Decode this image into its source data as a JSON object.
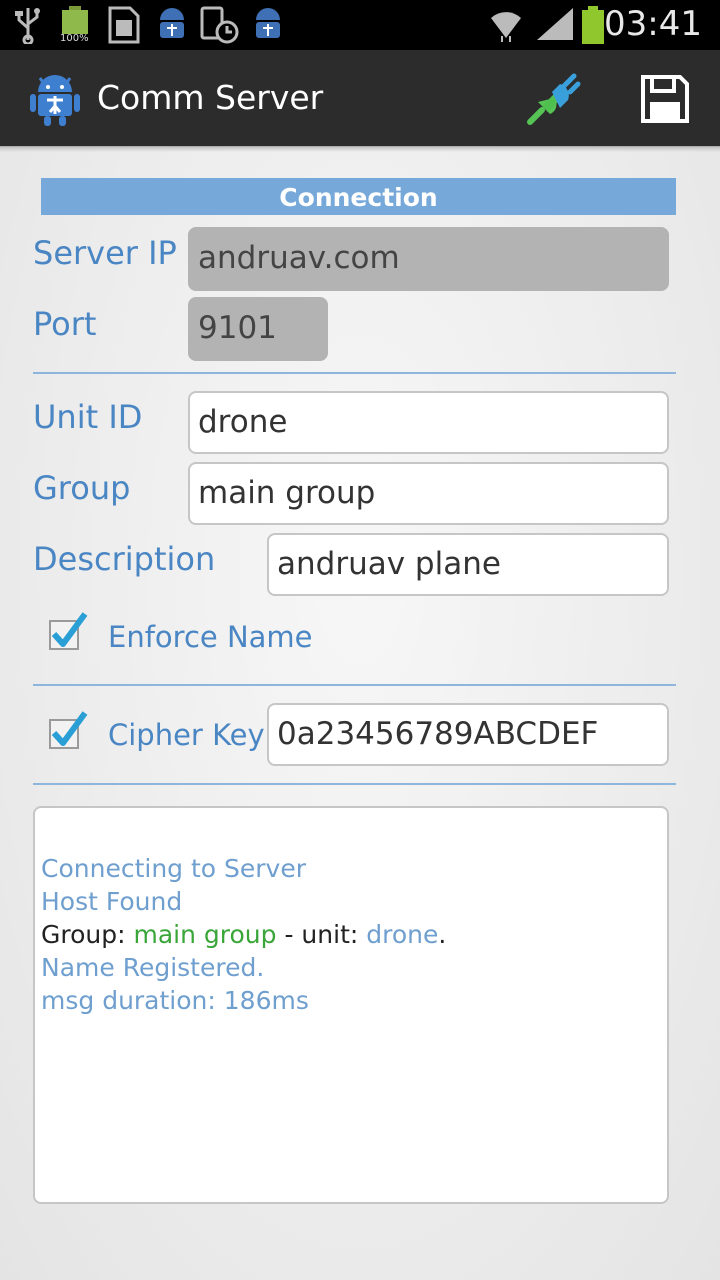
{
  "status_bar": {
    "time": "03:41",
    "battery_small_label": "100%",
    "icons": [
      "usb-icon",
      "battery-full-icon",
      "sd-card-icon",
      "android-app-icon",
      "screenshot-icon",
      "android-app-icon",
      "wifi-icon",
      "signal-icon",
      "battery-icon"
    ]
  },
  "action_bar": {
    "title": "Comm Server",
    "actions": [
      "connect-plug-icon",
      "save-floppy-icon"
    ]
  },
  "connection": {
    "header": "Connection",
    "server_ip_label": "Server IP",
    "server_ip_value": "andruav.com",
    "port_label": "Port",
    "port_value": "9101"
  },
  "identity": {
    "unit_id_label": "Unit ID",
    "unit_id_value": "drone",
    "group_label": "Group",
    "group_value": "main group",
    "description_label": "Description",
    "description_value": "andruav plane",
    "enforce_name_label": "Enforce Name",
    "enforce_name_checked": true
  },
  "cipher": {
    "label": "Cipher Key",
    "checked": true,
    "value": "0a23456789ABCDEF"
  },
  "log": {
    "line1": "Connecting to Server",
    "line2": "Host Found",
    "line3_prefix": "Group: ",
    "line3_group": "main group",
    "line3_mid": " - unit: ",
    "line3_unit": "drone",
    "line3_end": ".",
    "line4": "Name Registered.",
    "line5": "msg duration: 186ms"
  },
  "colors": {
    "accent": "#76a9d9",
    "label": "#4a86c3",
    "log_blue": "#6f9fcf",
    "log_green": "#3aa63a",
    "checkmark": "#2a9fd6"
  }
}
